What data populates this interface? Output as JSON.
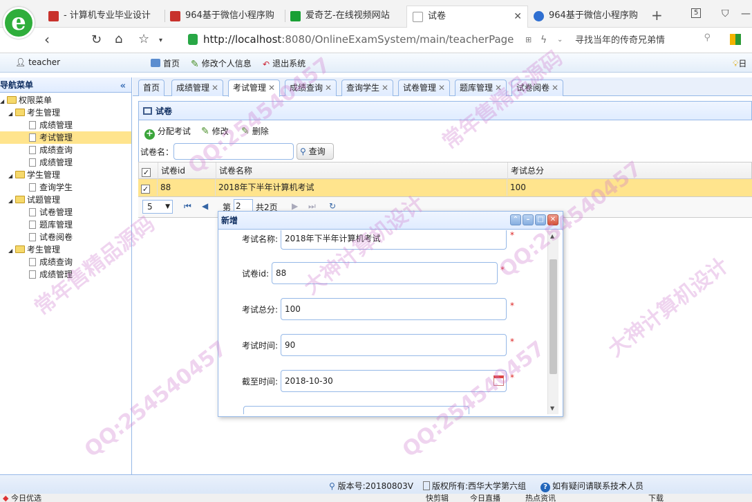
{
  "browser": {
    "tabs": [
      {
        "label": "- 计算机专业毕业设计",
        "color": "#c8322c"
      },
      {
        "label": "964基于微信小程序购",
        "color": "#c8322c"
      },
      {
        "label": "爱奇艺-在线视频网站",
        "color": "#1aa035"
      },
      {
        "label": "试卷",
        "color": "#ffffff"
      },
      {
        "label": "964基于微信小程序购",
        "color": "#2f6fd1"
      }
    ],
    "active_tab_index": 3,
    "tab_count_badge": "5",
    "url": {
      "host": "http://localhost",
      "rest": ":8080/OnlineExamSystem/main/teacherPage"
    },
    "search_text": "寻找当年的传奇兄弟情"
  },
  "header": {
    "user": "teacher",
    "links": [
      "首页",
      "修改个人信息",
      "退出系统"
    ],
    "right_text": "日"
  },
  "sidebar": {
    "title": "导航菜单",
    "collapse_icon": "«",
    "root": "权限菜单",
    "groups": [
      {
        "label": "考生管理",
        "items": [
          "成绩管理",
          "考试管理",
          "成绩查询",
          "成绩管理"
        ]
      },
      {
        "label": "学生管理",
        "items": [
          "查询学生"
        ]
      },
      {
        "label": "试题管理",
        "items": [
          "试卷管理",
          "题库管理",
          "试卷阅卷"
        ]
      },
      {
        "label": "考生管理",
        "items": [
          "成绩查询",
          "成绩管理"
        ]
      }
    ]
  },
  "tabs": [
    "首页",
    "成绩管理",
    "考试管理",
    "成绩查询",
    "查询学生",
    "试卷管理",
    "题库管理",
    "试卷阅卷"
  ],
  "panel": {
    "title": "试卷",
    "toolbar": {
      "add": "分配考试",
      "edit": "修改",
      "delete": "删除"
    },
    "search_label": "试卷名：",
    "search_button": "查询",
    "columns": [
      "试卷id",
      "试卷名称",
      "考试总分"
    ],
    "rows": [
      {
        "id": "88",
        "name": "2018年下半年计算机考试",
        "score": "100"
      }
    ],
    "pager": {
      "page_size": "5",
      "page_prefix": "第",
      "page_value": "2",
      "page_suffix": "共2页"
    }
  },
  "dialog": {
    "title": "新增",
    "fields": [
      {
        "label": "考试名称:",
        "value": "2018年下半年计算机考试"
      },
      {
        "label": "试卷id:",
        "value": "88"
      },
      {
        "label": "考试总分:",
        "value": "100"
      },
      {
        "label": "考试时间:",
        "value": "90"
      },
      {
        "label": "截至时间:",
        "value": "2018-10-30"
      }
    ],
    "required_mark": "*"
  },
  "footer": {
    "version": "版本号:20180803V",
    "copyright": "版权所有:西华大学第六组",
    "help": "如有疑问请联系技术人员"
  },
  "status_bar": {
    "left": "今日优选",
    "items": [
      "快剪辑",
      "今日直播",
      "热点资讯",
      "下载"
    ]
  },
  "watermark": {
    "texts": [
      "QQ:254540457",
      "常年售精品源码",
      "大神计算机设计"
    ],
    "color": "#cd78cd"
  }
}
